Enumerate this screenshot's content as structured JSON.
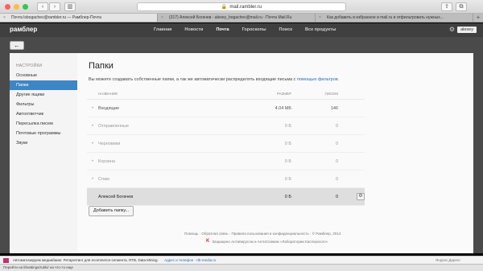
{
  "browser": {
    "url": "mail.rambler.ru",
    "tabs": [
      {
        "label": "Почта lsbogachev@rambler.ru — Рамблер-Почта",
        "active": true
      },
      {
        "label": "(317) Алексей Богачев - alexey_bogachev@mail.ru - Почта Mail.Ru",
        "active": false
      },
      {
        "label": "Как добавить в избранное в mail.ru и отфильтровать нужных...",
        "active": false
      }
    ]
  },
  "header": {
    "logo": "рамблер",
    "nav": [
      {
        "label": "Главная",
        "active": false
      },
      {
        "label": "Новости",
        "active": false
      },
      {
        "label": "Почта",
        "active": true
      },
      {
        "label": "Гороскопы",
        "active": false
      },
      {
        "label": "Поиск",
        "active": false
      },
      {
        "label": "Все продукты",
        "active": false
      }
    ],
    "user": "alexey"
  },
  "sidebar": {
    "section": "НАСТРОЙКИ",
    "items": [
      {
        "label": "Основные",
        "active": false
      },
      {
        "label": "Папки",
        "active": true
      },
      {
        "label": "Другие ящики",
        "active": false
      },
      {
        "label": "Фильтры",
        "active": false
      },
      {
        "label": "Автоответчик",
        "active": false
      },
      {
        "label": "Пересылка писем",
        "active": false
      },
      {
        "label": "Почтовые программы",
        "active": false
      },
      {
        "label": "Звуки",
        "active": false
      }
    ]
  },
  "main": {
    "title": "Папки",
    "intro_text": "Вы можете создавать собственные папки, а так же автоматически распределять входящие письма с ",
    "intro_link": "помощью фильтров.",
    "columns": {
      "name": "НАЗВАНИЕ",
      "size": "РАЗМЕР",
      "count": "ПИСЕМ"
    },
    "folders": [
      {
        "name": "Входящие",
        "size": "4.04 МБ",
        "count": "146"
      },
      {
        "name": "Отправленные",
        "size": "0 Б",
        "count": "0"
      },
      {
        "name": "Черновики",
        "size": "0 Б",
        "count": "0"
      },
      {
        "name": "Корзина",
        "size": "0 Б",
        "count": "0"
      },
      {
        "name": "Спам",
        "size": "0 Б",
        "count": "0"
      },
      {
        "name": "Алексей Богачев",
        "size": "0 Б",
        "count": "0"
      }
    ],
    "add_button": "Добавить папку...",
    "footer_links": "Помощь · Обратная связь · Правила пользования и конфиденциальность · © Рамблер, 2014",
    "footer_ad": "Защищено Антивирусом и АнтиСпамом «Лаборатории Касперского»"
  },
  "adbar": {
    "text": "Автоматизируем медиабаинг. Ретаргетинг для ecommerce-сегмента. RTB, Data Mining.",
    "link": "Адрес и телефон · rtb-media.ru",
    "right": "Яндекс.Директ"
  },
  "status": "Перейти на lifeattings/rubki/ на что-то еще"
}
